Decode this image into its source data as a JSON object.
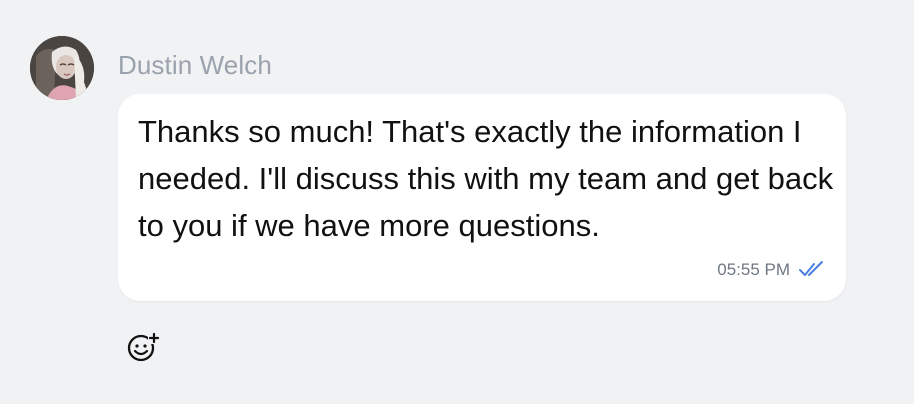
{
  "message": {
    "sender_name": "Dustin Welch",
    "text": "Thanks so much! That's exactly the information I needed. I'll discuss this with my team and get back to you if we have more questions.",
    "timestamp": "05:55 PM",
    "status_icon": "double-check-icon",
    "status_color": "#4a7de0"
  },
  "reaction": {
    "icon": "add-reaction-icon"
  },
  "colors": {
    "page_background": "#f1f2f4",
    "bubble_background": "#ffffff",
    "name_color": "#9aa2ad",
    "timestamp_color": "#6f7782"
  }
}
